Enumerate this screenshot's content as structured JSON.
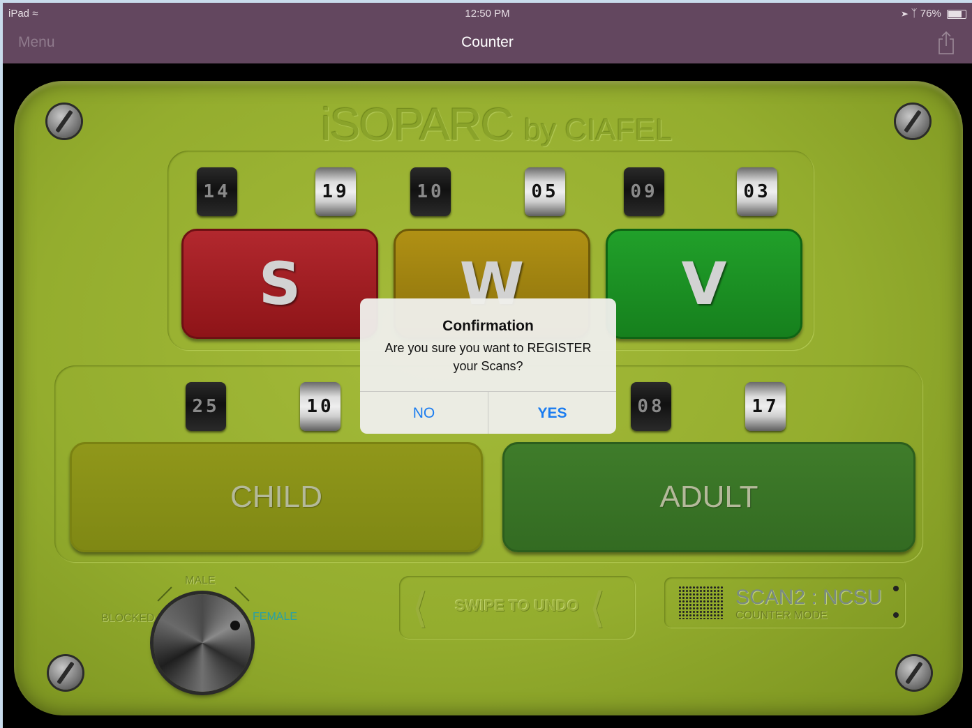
{
  "status_bar": {
    "device": "iPad",
    "time": "12:50 PM",
    "battery": "76%"
  },
  "nav": {
    "menu_label": "Menu",
    "title": "Counter"
  },
  "panel": {
    "brand": "iSOPARC",
    "brand_by": "by CIAFEL"
  },
  "top_counters": [
    "14",
    "19",
    "10",
    "05",
    "09",
    "03"
  ],
  "activity_buttons": {
    "s": "S",
    "w": "W",
    "v": "V"
  },
  "bottom_counters": [
    "25",
    "10",
    "08",
    "17"
  ],
  "age_buttons": {
    "child": "CHILD",
    "adult": "ADULT"
  },
  "knob": {
    "male_label": "MALE",
    "blocked_label": "BLOCKED",
    "female_label": "FEMALE",
    "selected": "FEMALE"
  },
  "undo": {
    "label": "SWIPE TO UNDO"
  },
  "scan": {
    "title": "SCAN2 : NCSU",
    "mode": "COUNTER MODE"
  },
  "dialog": {
    "title": "Confirmation",
    "message": "Are you sure you want to REGISTER your Scans?",
    "no_label": "NO",
    "yes_label": "YES"
  },
  "colors": {
    "nav_bg": "#63475f",
    "panel_green": "#94ad2e",
    "s_red": "#a01e23",
    "w_yellow": "#9e820f",
    "v_green": "#1c9023",
    "dialog_link": "#1a7cf0"
  }
}
